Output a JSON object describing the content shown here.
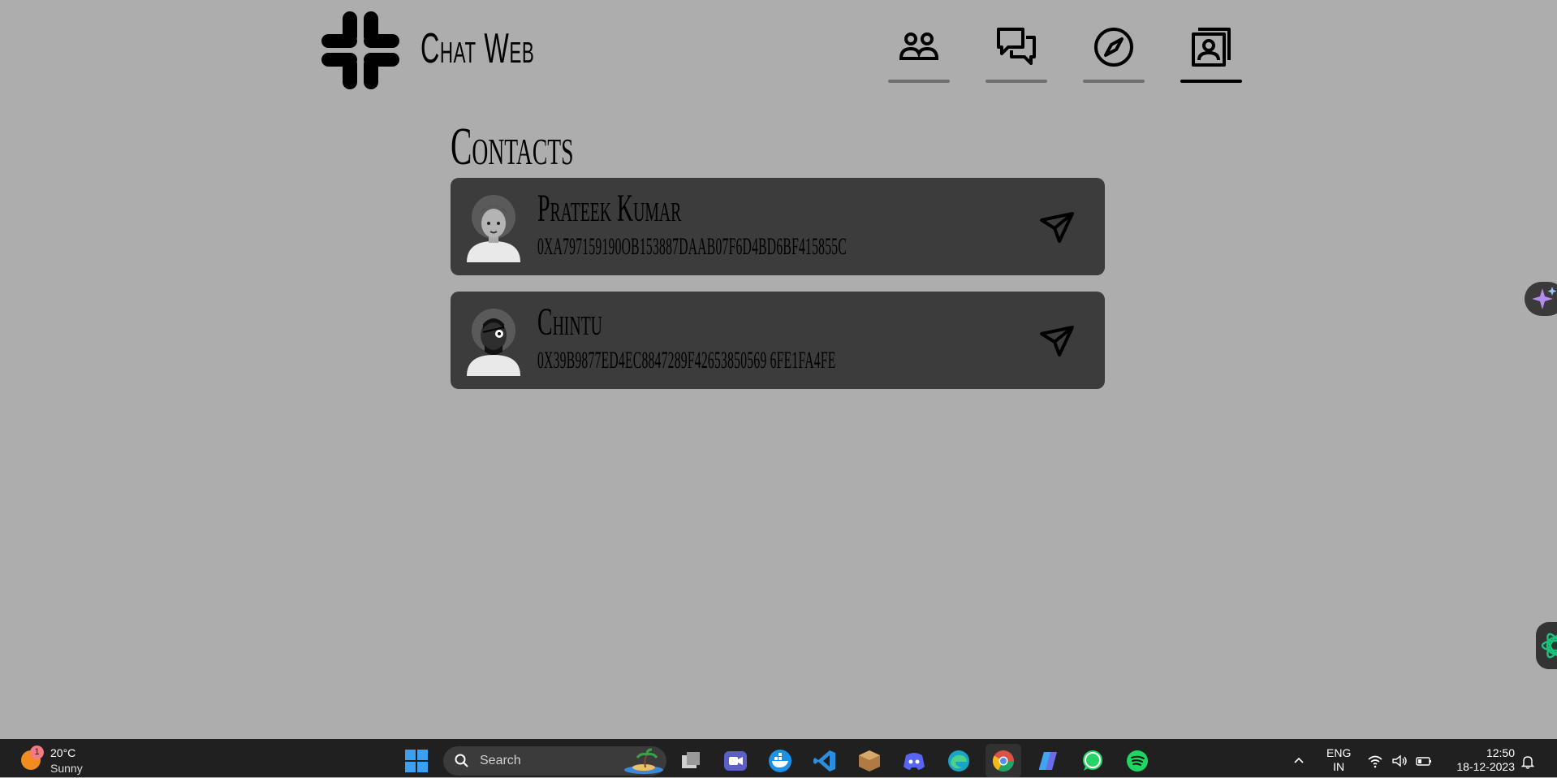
{
  "app": {
    "title": "Chat Web",
    "nav": [
      {
        "name": "users",
        "active": false
      },
      {
        "name": "chats",
        "active": false
      },
      {
        "name": "explore",
        "active": false
      },
      {
        "name": "contacts",
        "active": true
      }
    ]
  },
  "contacts": {
    "title": "Contacts",
    "items": [
      {
        "name": "Prateek Kumar",
        "address": "0xA797159190OB153887DAAB07F6D4BD6BF415855C"
      },
      {
        "name": "Chintu",
        "address": "0x39B9877ED4EC8847289F42653850569 6FE1FA4FE"
      }
    ]
  },
  "taskbar": {
    "weather": {
      "badge": "1",
      "temp": "20°C",
      "condition": "Sunny"
    },
    "search_placeholder": "Search",
    "lang_line1": "ENG",
    "lang_line2": "IN",
    "time": "12:50",
    "date": "18-12-2023"
  },
  "colors": {
    "page_bg": "#adadad",
    "card_bg": "#3c3c3c",
    "taskbar_bg": "#202020",
    "nav_underline": "#6e6e6e",
    "nav_underline_active": "#000000"
  }
}
